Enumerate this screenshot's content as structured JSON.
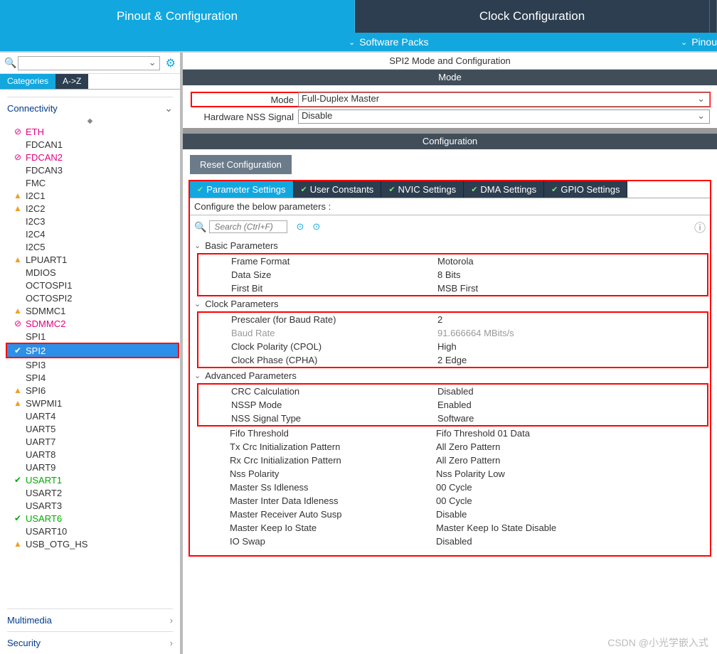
{
  "top_tabs": {
    "pinout": "Pinout & Configuration",
    "clock": "Clock Configuration"
  },
  "sub_bar": {
    "software_packs": "Software Packs",
    "pinout": "Pinou"
  },
  "side_tabs": {
    "categories": "Categories",
    "az": "A->Z"
  },
  "category": {
    "connectivity": "Connectivity",
    "multimedia": "Multimedia",
    "security": "Security"
  },
  "peripherals": [
    {
      "name": "ETH",
      "status": "red"
    },
    {
      "name": "FDCAN1",
      "status": ""
    },
    {
      "name": "FDCAN2",
      "status": "red"
    },
    {
      "name": "FDCAN3",
      "status": ""
    },
    {
      "name": "FMC",
      "status": ""
    },
    {
      "name": "I2C1",
      "status": "yellow"
    },
    {
      "name": "I2C2",
      "status": "yellow"
    },
    {
      "name": "I2C3",
      "status": ""
    },
    {
      "name": "I2C4",
      "status": ""
    },
    {
      "name": "I2C5",
      "status": ""
    },
    {
      "name": "LPUART1",
      "status": "yellow"
    },
    {
      "name": "MDIOS",
      "status": ""
    },
    {
      "name": "OCTOSPI1",
      "status": ""
    },
    {
      "name": "OCTOSPI2",
      "status": ""
    },
    {
      "name": "SDMMC1",
      "status": "yellow"
    },
    {
      "name": "SDMMC2",
      "status": "red"
    },
    {
      "name": "SPI1",
      "status": ""
    },
    {
      "name": "SPI2",
      "status": "green",
      "selected": true
    },
    {
      "name": "SPI3",
      "status": ""
    },
    {
      "name": "SPI4",
      "status": ""
    },
    {
      "name": "SPI6",
      "status": "yellow"
    },
    {
      "name": "SWPMI1",
      "status": "yellow"
    },
    {
      "name": "UART4",
      "status": ""
    },
    {
      "name": "UART5",
      "status": ""
    },
    {
      "name": "UART7",
      "status": ""
    },
    {
      "name": "UART8",
      "status": ""
    },
    {
      "name": "UART9",
      "status": ""
    },
    {
      "name": "USART1",
      "status": "green"
    },
    {
      "name": "USART2",
      "status": ""
    },
    {
      "name": "USART3",
      "status": ""
    },
    {
      "name": "USART6",
      "status": "green"
    },
    {
      "name": "USART10",
      "status": ""
    },
    {
      "name": "USB_OTG_HS",
      "status": "yellow"
    }
  ],
  "right": {
    "title": "SPI2 Mode and Configuration",
    "mode_header": "Mode",
    "mode_label": "Mode",
    "mode_value": "Full-Duplex Master",
    "nss_label": "Hardware NSS Signal",
    "nss_value": "Disable",
    "config_header": "Configuration",
    "reset_btn": "Reset Configuration",
    "tabs": [
      "Parameter Settings",
      "User Constants",
      "NVIC Settings",
      "DMA Settings",
      "GPIO Settings"
    ],
    "configure_hint": "Configure the below parameters :",
    "search_placeholder": "Search (Ctrl+F)",
    "sections": {
      "basic": {
        "title": "Basic Parameters",
        "rows": [
          {
            "n": "Frame Format",
            "v": "Motorola"
          },
          {
            "n": "Data Size",
            "v": "8 Bits"
          },
          {
            "n": "First Bit",
            "v": "MSB First"
          }
        ]
      },
      "clock": {
        "title": "Clock Parameters",
        "rows": [
          {
            "n": "Prescaler (for Baud Rate)",
            "v": "2"
          },
          {
            "n": "Baud Rate",
            "v": "91.666664 MBits/s",
            "disabled": true
          },
          {
            "n": "Clock Polarity (CPOL)",
            "v": "High"
          },
          {
            "n": "Clock Phase (CPHA)",
            "v": "2 Edge"
          }
        ]
      },
      "advanced": {
        "title": "Advanced Parameters",
        "rows_boxed": [
          {
            "n": "CRC Calculation",
            "v": "Disabled"
          },
          {
            "n": "NSSP Mode",
            "v": "Enabled"
          },
          {
            "n": "NSS Signal Type",
            "v": "Software"
          }
        ],
        "rows": [
          {
            "n": "Fifo Threshold",
            "v": "Fifo Threshold 01 Data"
          },
          {
            "n": "Tx Crc Initialization Pattern",
            "v": "All Zero Pattern"
          },
          {
            "n": "Rx Crc Initialization Pattern",
            "v": "All Zero Pattern"
          },
          {
            "n": "Nss Polarity",
            "v": "Nss Polarity Low"
          },
          {
            "n": "Master Ss Idleness",
            "v": "00 Cycle"
          },
          {
            "n": "Master Inter Data Idleness",
            "v": "00 Cycle"
          },
          {
            "n": "Master Receiver Auto Susp",
            "v": "Disable"
          },
          {
            "n": "Master Keep Io State",
            "v": "Master Keep Io State Disable"
          },
          {
            "n": "IO Swap",
            "v": "Disabled"
          }
        ]
      }
    }
  },
  "watermark": "CSDN @小光学嵌入式"
}
